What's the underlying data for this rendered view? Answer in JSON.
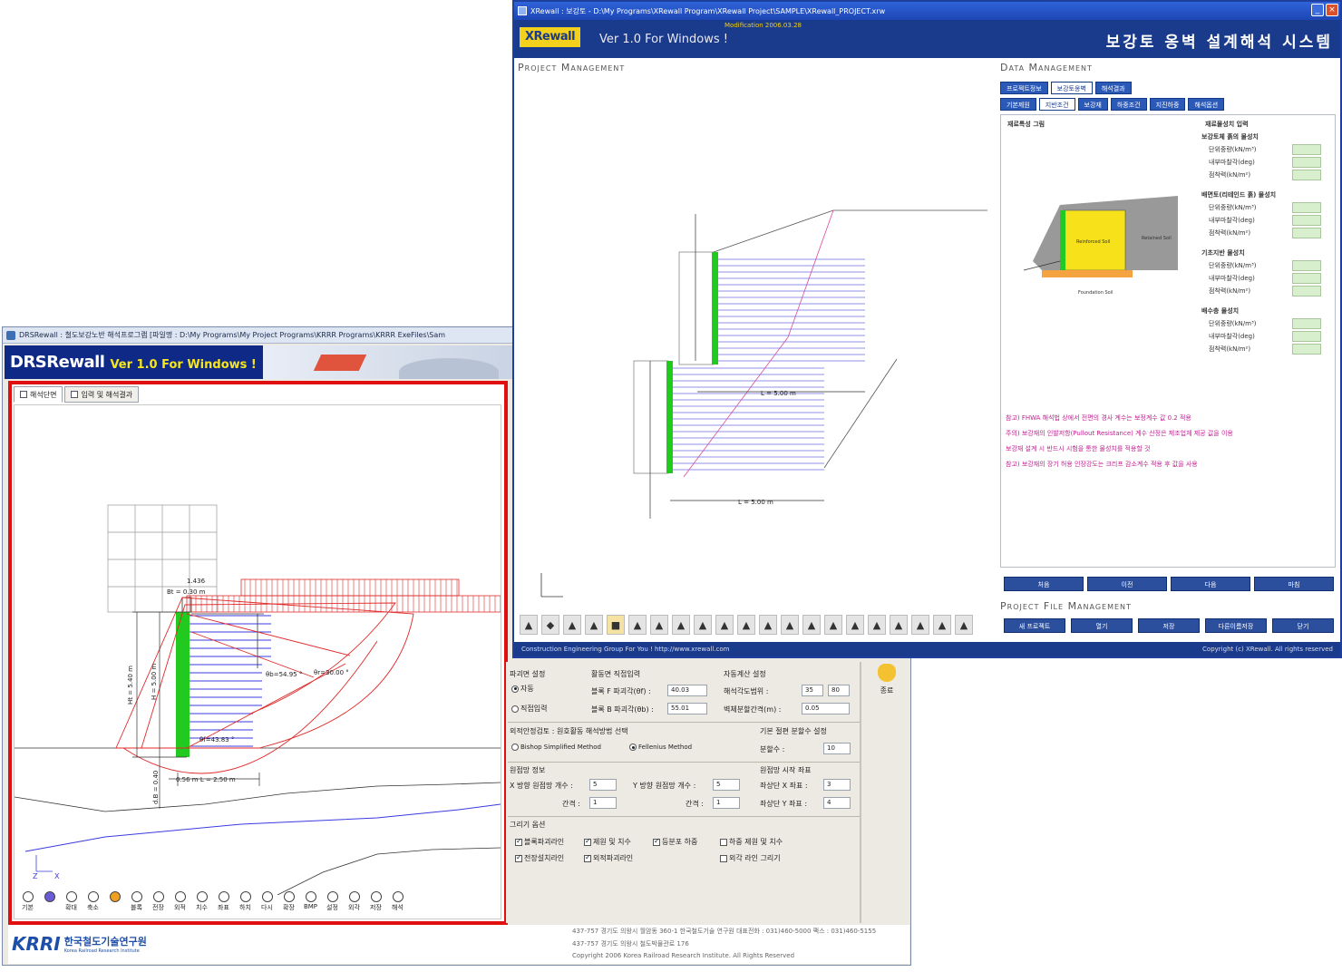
{
  "win1": {
    "title": "DRSRewall : 철도보강노반 해석프로그램 [파일명 : D:\\My Programs\\My Project Programs\\KRRR Programs\\KRRR ExeFiles\\Sam",
    "banner_logo": "DRSRewall",
    "banner_version": "Ver 1.0 For Windows !",
    "tabs": [
      "해석단면",
      "입력 및 해석결과"
    ],
    "drawing": {
      "top_dim": "1.436",
      "bt": "Bt = 0.30 m",
      "ht": "Ht = 5.40 m",
      "h": "H = 5.00 m",
      "theta_b": "θb=54.95 °",
      "theta_r": "θr=30.00 °",
      "theta_f": "θf=43.83 °",
      "db": "d.B = 0.40",
      "bottom_b": "B",
      "bottom_dims": "0.56 m   L = 2.50 m",
      "axis_z": "Z",
      "axis_x": "X"
    },
    "toolbar": [
      "기본",
      "",
      "확대",
      "축소",
      "",
      "블록",
      "전장",
      "외적",
      "치수",
      "좌표",
      "하치",
      "다시",
      "확장",
      "BMP",
      "설정",
      "외각",
      "저장",
      "해석"
    ],
    "panel": {
      "failure_title": "파괴면 설정",
      "auto": "자동",
      "direct_input": "직접입력",
      "block_title": "활동면 직접입력",
      "block_f": "블록 F 파괴각(θf) :",
      "block_f_val": "40.03",
      "block_b": "블록 B 파괴각(θb) :",
      "block_b_val": "55.01",
      "auto_title": "자동계산 설정",
      "range_label": "해석각도범위 :",
      "range_from": "35",
      "range_to": "80",
      "interval_label": "벽체분할간격(m) :",
      "interval_val": "0.05",
      "ext_title": "외적안정검토 : 원호활동 해석방법 선택",
      "bishop": "Bishop Simplified Method",
      "fellenius": "Fellenius Method",
      "slice_title": "기본 절편 분할수 설정",
      "slice_label": "분할수 :",
      "slice_val": "10",
      "grid_title": "원점망 정보",
      "x_count": "X 방향 원점망 개수 :",
      "x_count_val": "5",
      "x_gap": "간격 :",
      "x_gap_val": "1",
      "y_count": "Y 방향 원점망 개수 :",
      "y_count_val": "5",
      "y_gap": "간격 :",
      "y_gap_val": "1",
      "start_title": "원점망 시작 좌표",
      "start_x": "좌상단 X 좌표 :",
      "start_x_val": "3",
      "start_y": "좌상단 Y 좌표 :",
      "start_y_val": "4",
      "draw_title": "그리기 옵션",
      "opt1": "블록파괴라인",
      "opt2": "제원 및 치수",
      "opt3": "등분포 하중",
      "opt4": "하중 제원 및 치수",
      "opt5": "전장설치라인",
      "opt6": "외적파괴라인",
      "opt7": "외각 라인 그리기",
      "exit": "종료"
    },
    "footer": {
      "krri_mark": "KRRI",
      "krri_ko": "한국철도기술연구원",
      "krri_en": "Korea Railroad Research Institute",
      "addr1": "437-757  경기도 의왕시 월암동 360-1 한국철도기술 연구원    대표전화 : 031)460-5000    팩스 : 031)460-5155",
      "addr2": "437-757  경기도 의왕시 철도박물관로 176",
      "copyright": "Copyright 2006 Korea Railroad Research Institute. All Rights Reserved"
    }
  },
  "win2": {
    "title": "XRewall : 보강토 - D:\\My Programs\\XRewall Program\\XRewall Project\\SAMPLE\\XRewall_PROJECT.xrw",
    "logo": "XRewall",
    "version": "Ver 1.0 For Windows !",
    "subtitle": "Modification 2006.03.28",
    "system_title": "보강토 옹벽 설계해석 시스템",
    "project_mgmt": "Project Management",
    "data_mgmt": "Data Management",
    "file_mgmt": "Project File Management",
    "tabs_row1": [
      "프로젝트정보",
      "보강토옹벽",
      "해석결과"
    ],
    "tabs_row2": [
      "기본제원",
      "지반조건",
      "보강재",
      "하중조건",
      "지진하중",
      "해석옵션"
    ],
    "diagram_title": "재료특성 그림",
    "props_title": "재료물성치 입력",
    "props": [
      "보강토체 흙의 물성치",
      "단위중량(kN/m³)",
      "내부마찰각(deg)",
      "점착력(kN/m²)",
      "배면토(리테인드 흙) 물성치",
      "단위중량(kN/m³)",
      "내부마찰각(deg)",
      "점착력(kN/m²)",
      "기초지반 물성치",
      "단위중량(kN/m³)",
      "내부마찰각(deg)",
      "점착력(kN/m²)",
      "배수층 물성치",
      "단위중량(kN/m³)",
      "내부마찰각(deg)",
      "점착력(kN/m²)"
    ],
    "diagram_labels": {
      "reinforced": "Reinforced Soil",
      "retained": "Retained Soil",
      "foundation": "Foundation Soil"
    },
    "drawing": {
      "dim_l": "L = 5.00 m",
      "dim_b": "L = 5.00 m"
    },
    "notes": [
      "참고) FHWA 해석법 상에서 전면의 경사 계수는 보정계수 값 0.2 적용",
      "주의) 보강재의 인발저항(Pullout Resistance) 계수 산정은 제조업체 제공 값을 이용",
      "      보강재 설계 시 반드시 시험을 통한 물성치를 적용할 것",
      "참고) 보강재의 장기 허용 인장강도는 크리프 감소계수 적용 후 값을 사용"
    ],
    "nav": [
      "처음",
      "이전",
      "다음",
      "마침"
    ],
    "file_buttons": [
      "새 프로젝트",
      "열기",
      "저장",
      "다른이름저장",
      "닫기"
    ],
    "status_left": "Construction Engineering Group For You ! http://www.xrewall.com",
    "status_right": "Copyright (c) XRewall. All rights reserved"
  },
  "colors": {
    "frame_red": "#e01010",
    "banner_blue": "#0f2a86",
    "win_blue": "#1a3a8c",
    "green_wall": "#22c91e",
    "reinforcement": "#3a3ae0",
    "slip_circle": "#e02a2a"
  }
}
